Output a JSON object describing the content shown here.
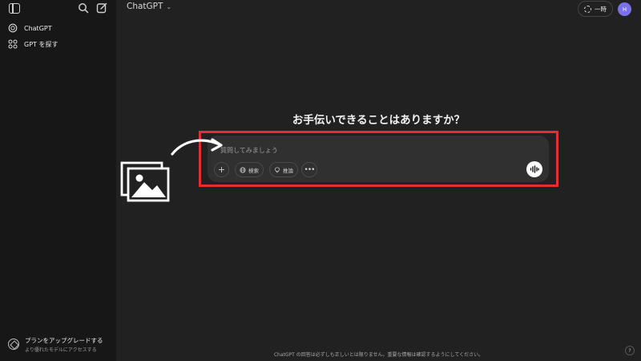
{
  "sidebar": {
    "items": [
      {
        "label": "ChatGPT",
        "icon": "chatgpt-logo-icon"
      },
      {
        "label": "GPT を探す",
        "icon": "grid-icon"
      }
    ],
    "upgrade": {
      "title": "プランをアップグレードする",
      "subtitle": "より優れたモデルにアクセスする"
    }
  },
  "header": {
    "model_label": "ChatGPT",
    "temp_label": "一時",
    "avatar_initial": "H"
  },
  "main": {
    "greeting": "お手伝いできることはありますか？",
    "composer": {
      "placeholder": "質問してみましょう",
      "search_label": "検索",
      "think_label": "推論"
    },
    "disclaimer": "ChatGPT の回答は必ずしも正しいとは限りません。重要な情報は確認するようにしてください。",
    "help_label": "?"
  },
  "colors": {
    "background": "#212121",
    "sidebar": "#171717",
    "composer": "#303030",
    "highlight": "#e2302c",
    "avatar": "#7b72e9"
  }
}
